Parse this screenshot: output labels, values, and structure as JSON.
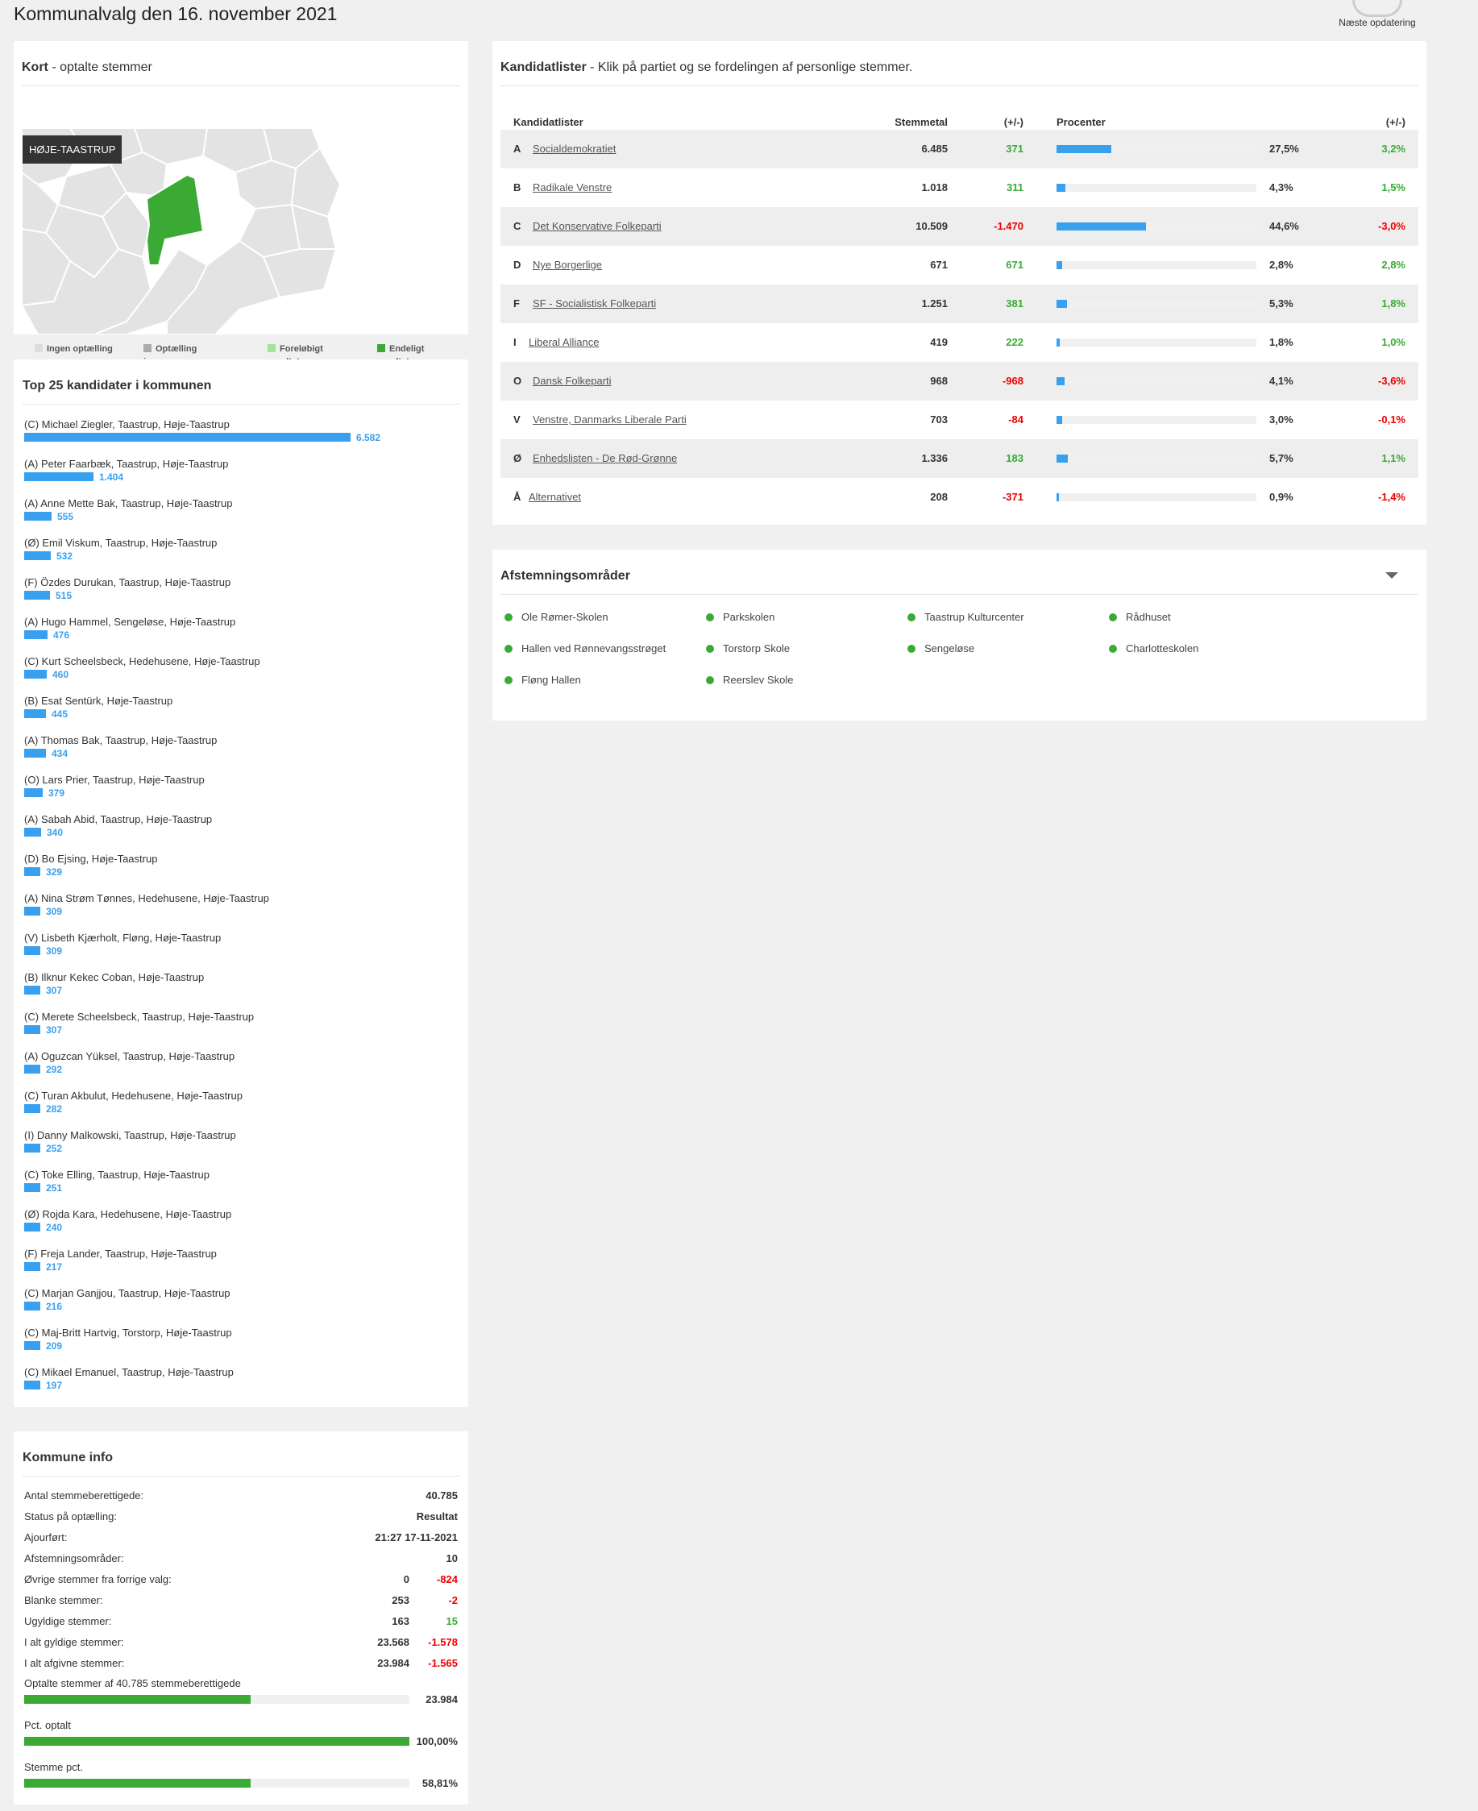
{
  "page": {
    "title": "Kommunalvalg den 16. november 2021",
    "next_update_label": "Næste opdatering"
  },
  "map": {
    "title_bold": "Kort",
    "title_rest": " - optalte stemmer",
    "municipality_tag": "HØJE-TAASTRUP",
    "legend": [
      {
        "label": "Ingen optælling",
        "color": "#dddddd"
      },
      {
        "label": "Optælling igang",
        "color": "#aaaaaa"
      },
      {
        "label": "Foreløbigt resultat",
        "color": "#a5e39d"
      },
      {
        "label": "Endeligt resultat",
        "color": "#3aaa35"
      }
    ]
  },
  "top25": {
    "title": "Top 25 kandidater i kommunen",
    "candidates": [
      {
        "name": "(C) Michael Ziegler, Taastrup, Høje-Taastrup",
        "votes": "6.582",
        "value": 6582
      },
      {
        "name": "(A) Peter Faarbæk, Taastrup, Høje-Taastrup",
        "votes": "1.404",
        "value": 1404
      },
      {
        "name": "(A) Anne Mette Bak, Taastrup, Høje-Taastrup",
        "votes": "555",
        "value": 555
      },
      {
        "name": "(Ø) Emil Viskum, Taastrup, Høje-Taastrup",
        "votes": "532",
        "value": 532
      },
      {
        "name": "(F) Özdes Durukan, Taastrup, Høje-Taastrup",
        "votes": "515",
        "value": 515
      },
      {
        "name": "(A) Hugo Hammel, Sengeløse, Høje-Taastrup",
        "votes": "476",
        "value": 476
      },
      {
        "name": "(C) Kurt Scheelsbeck, Hedehusene, Høje-Taastrup",
        "votes": "460",
        "value": 460
      },
      {
        "name": "(B) Esat Sentürk, Høje-Taastrup",
        "votes": "445",
        "value": 445
      },
      {
        "name": "(A) Thomas Bak, Taastrup, Høje-Taastrup",
        "votes": "434",
        "value": 434
      },
      {
        "name": "(O) Lars Prier, Taastrup, Høje-Taastrup",
        "votes": "379",
        "value": 379
      },
      {
        "name": "(A) Sabah Abid, Taastrup, Høje-Taastrup",
        "votes": "340",
        "value": 340
      },
      {
        "name": "(D) Bo Ejsing, Høje-Taastrup",
        "votes": "329",
        "value": 329
      },
      {
        "name": "(A) Nina Strøm Tønnes, Hedehusene, Høje-Taastrup",
        "votes": "309",
        "value": 309
      },
      {
        "name": "(V) Lisbeth Kjærholt, Fløng, Høje-Taastrup",
        "votes": "309",
        "value": 309
      },
      {
        "name": "(B) Ilknur Kekec Coban, Høje-Taastrup",
        "votes": "307",
        "value": 307
      },
      {
        "name": "(C) Merete Scheelsbeck, Taastrup, Høje-Taastrup",
        "votes": "307",
        "value": 307
      },
      {
        "name": "(A) Oguzcan Yüksel, Taastrup, Høje-Taastrup",
        "votes": "292",
        "value": 292
      },
      {
        "name": "(C) Turan Akbulut, Hedehusene, Høje-Taastrup",
        "votes": "282",
        "value": 282
      },
      {
        "name": "(I) Danny Malkowski, Taastrup, Høje-Taastrup",
        "votes": "252",
        "value": 252
      },
      {
        "name": "(C) Toke Elling, Taastrup, Høje-Taastrup",
        "votes": "251",
        "value": 251
      },
      {
        "name": "(Ø) Rojda Kara, Hedehusene, Høje-Taastrup",
        "votes": "240",
        "value": 240
      },
      {
        "name": "(F) Freja Lander, Taastrup, Høje-Taastrup",
        "votes": "217",
        "value": 217
      },
      {
        "name": "(C) Marjan Ganjjou, Taastrup, Høje-Taastrup",
        "votes": "216",
        "value": 216
      },
      {
        "name": "(C) Maj-Britt Hartvig, Torstorp, Høje-Taastrup",
        "votes": "209",
        "value": 209
      },
      {
        "name": "(C) Mikael Emanuel, Taastrup, Høje-Taastrup",
        "votes": "197",
        "value": 197
      }
    ]
  },
  "info": {
    "title": "Kommune info",
    "rows": [
      {
        "label": "Antal stemmeberettigede:",
        "value": "40.785"
      },
      {
        "label": "Status på optælling:",
        "value": "Resultat"
      },
      {
        "label": "Ajourført:",
        "value": "21:27 17-11-2021"
      },
      {
        "label": "Afstemningsområder:",
        "value": "10"
      },
      {
        "label": "Øvrige stemmer fra forrige valg:",
        "value": "0",
        "change": "-824",
        "sign": "neg"
      },
      {
        "label": "Blanke stemmer:",
        "value": "253",
        "change": "-2",
        "sign": "neg"
      },
      {
        "label": "Ugyldige stemmer:",
        "value": "163",
        "change": "15",
        "sign": "pos"
      },
      {
        "label": "I alt gyldige stemmer:",
        "value": "23.568",
        "change": "-1.578",
        "sign": "neg"
      },
      {
        "label": "I alt afgivne stemmer:",
        "value": "23.984",
        "change": "-1.565",
        "sign": "neg"
      }
    ],
    "progress": [
      {
        "label": "Optalte stemmer af 40.785 stemmeberettigede",
        "value": "23.984",
        "fraction": 0.5881
      },
      {
        "label": "Pct. optalt",
        "value": "100,00%",
        "fraction": 1.0
      },
      {
        "label": "Stemme pct.",
        "value": "58,81%",
        "fraction": 0.5881
      }
    ]
  },
  "parties": {
    "title_bold": "Kandidatlister",
    "title_rest": " - Klik på partiet og se fordelingen af personlige stemmer.",
    "headers": {
      "list": "Kandidatlister",
      "votes": "Stemmetal",
      "diff": "(+/-)",
      "percent": "Procenter",
      "pdiff": "(+/-)"
    },
    "rows": [
      {
        "letter": "A",
        "name": "Socialdemokratiet",
        "votes": "6.485",
        "diff": "371",
        "diff_sign": "pos",
        "pct": "27,5%",
        "pct_value": 27.5,
        "pdiff": "3,2%",
        "pdiff_sign": "pos"
      },
      {
        "letter": "B",
        "name": "Radikale Venstre",
        "votes": "1.018",
        "diff": "311",
        "diff_sign": "pos",
        "pct": "4,3%",
        "pct_value": 4.3,
        "pdiff": "1,5%",
        "pdiff_sign": "pos"
      },
      {
        "letter": "C",
        "name": "Det Konservative Folkeparti",
        "votes": "10.509",
        "diff": "-1.470",
        "diff_sign": "neg",
        "pct": "44,6%",
        "pct_value": 44.6,
        "pdiff": "-3,0%",
        "pdiff_sign": "neg"
      },
      {
        "letter": "D",
        "name": "Nye Borgerlige",
        "votes": "671",
        "diff": "671",
        "diff_sign": "pos",
        "pct": "2,8%",
        "pct_value": 2.8,
        "pdiff": "2,8%",
        "pdiff_sign": "pos"
      },
      {
        "letter": "F",
        "name": "SF - Socialistisk Folkeparti",
        "votes": "1.251",
        "diff": "381",
        "diff_sign": "pos",
        "pct": "5,3%",
        "pct_value": 5.3,
        "pdiff": "1,8%",
        "pdiff_sign": "pos"
      },
      {
        "letter": "I",
        "name": "Liberal Alliance",
        "votes": "419",
        "diff": "222",
        "diff_sign": "pos",
        "pct": "1,8%",
        "pct_value": 1.8,
        "pdiff": "1,0%",
        "pdiff_sign": "pos"
      },
      {
        "letter": "O",
        "name": "Dansk Folkeparti",
        "votes": "968",
        "diff": "-968",
        "diff_sign": "neg",
        "pct": "4,1%",
        "pct_value": 4.1,
        "pdiff": "-3,6%",
        "pdiff_sign": "neg"
      },
      {
        "letter": "V",
        "name": "Venstre, Danmarks Liberale Parti",
        "votes": "703",
        "diff": "-84",
        "diff_sign": "neg",
        "pct": "3,0%",
        "pct_value": 3.0,
        "pdiff": "-0,1%",
        "pdiff_sign": "neg"
      },
      {
        "letter": "Ø",
        "name": "Enhedslisten - De Rød-Grønne",
        "votes": "1.336",
        "diff": "183",
        "diff_sign": "pos",
        "pct": "5,7%",
        "pct_value": 5.7,
        "pdiff": "1,1%",
        "pdiff_sign": "pos"
      },
      {
        "letter": "Å",
        "name": "Alternativet",
        "votes": "208",
        "diff": "-371",
        "diff_sign": "neg",
        "pct": "0,9%",
        "pct_value": 0.9,
        "pdiff": "-1,4%",
        "pdiff_sign": "neg"
      }
    ]
  },
  "areas": {
    "title": "Afstemningsområder",
    "items": [
      "Ole Rømer-Skolen",
      "Parkskolen",
      "Taastrup Kulturcenter",
      "Rådhuset",
      "Hallen ved Rønnevangsstrøget",
      "Torstorp Skole",
      "Sengeløse",
      "Charlotteskolen",
      "Fløng Hallen",
      "Reerslev Skole"
    ]
  },
  "colors": {
    "accent_blue": "#39a0ef",
    "result_green": "#3aaa35",
    "negative_red": "#ee0000"
  }
}
